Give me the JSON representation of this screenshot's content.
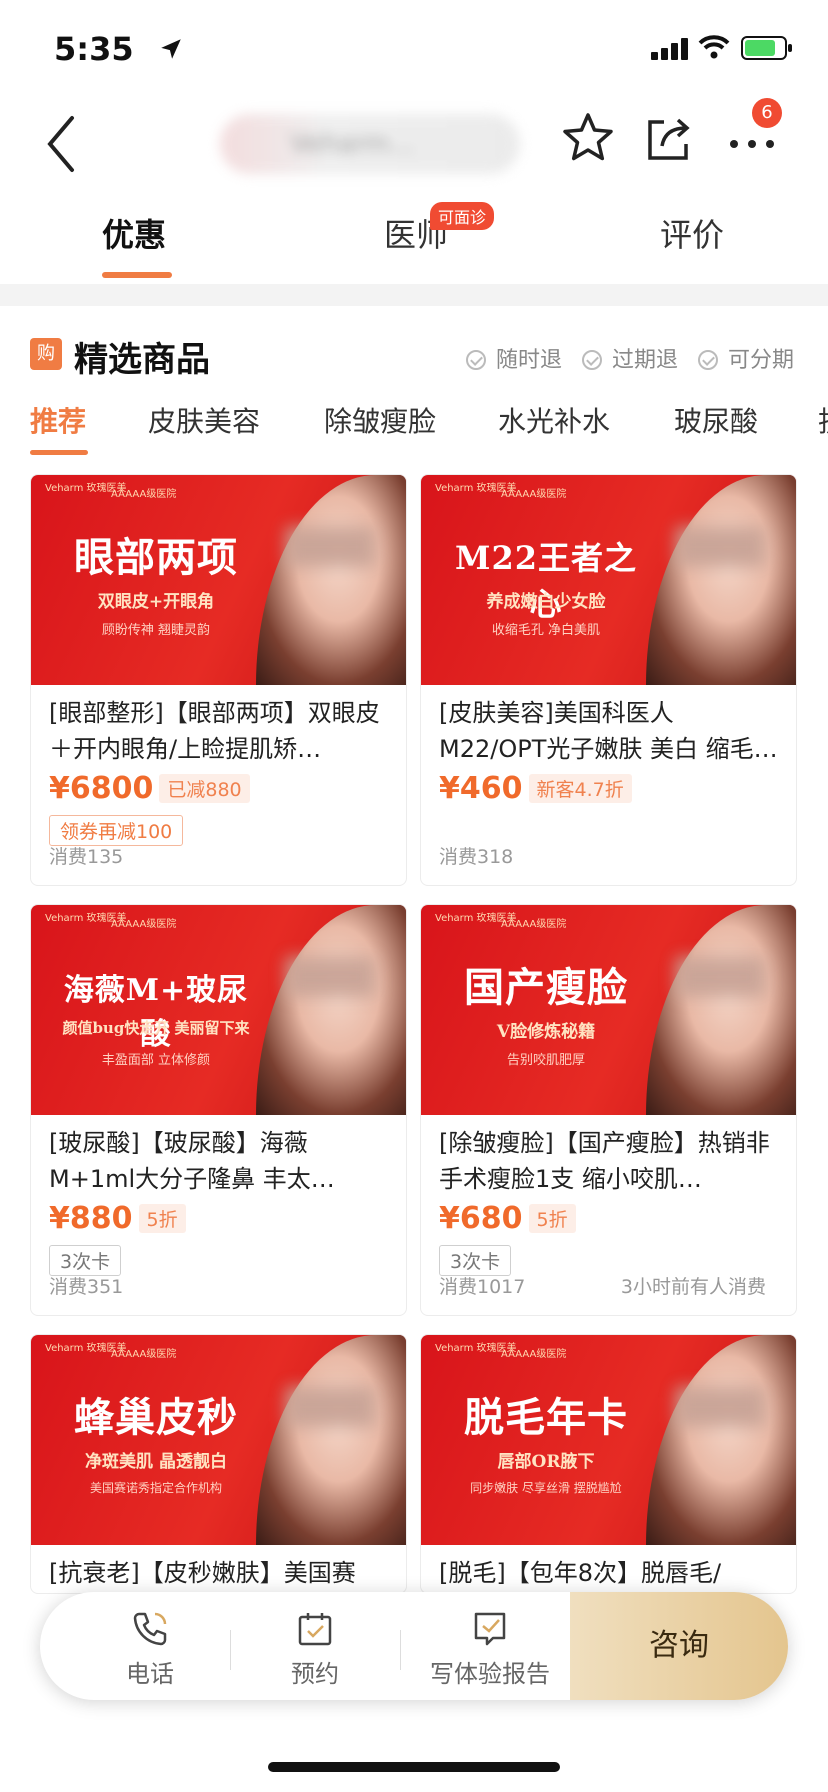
{
  "status": {
    "time": "5:35"
  },
  "nav": {
    "shop_name": "Veharm…",
    "notification_count": "6"
  },
  "tabs": [
    {
      "label": "优惠"
    },
    {
      "label": "医师",
      "badge": "可面诊"
    },
    {
      "label": "评价"
    }
  ],
  "section": {
    "icon_text": "购",
    "title": "精选商品",
    "assurances": [
      "随时退",
      "过期退",
      "可分期"
    ]
  },
  "categories": [
    "推荐",
    "皮肤美容",
    "除皱瘦脸",
    "水光补水",
    "玻尿酸",
    "抗"
  ],
  "products": [
    {
      "banner_title": "眼部两项",
      "banner_sub": "双眼皮+开眼角",
      "banner_small": "顾盼传神 翘睫灵韵",
      "title": "[眼部整形]【眼部两项】双眼皮＋开内眼角/上睑提肌矫…",
      "price": "¥6800",
      "badge": "已减880",
      "coupon": "领券再减100",
      "sales": "消费135",
      "recent": ""
    },
    {
      "banner_title": "M22王者之心",
      "banner_sub": "养成嫩白少女脸",
      "banner_small": "收缩毛孔 净白美肌",
      "title": "[皮肤美容]美国科医人M22/OPT光子嫩肤 美白 缩毛…",
      "price": "¥460",
      "badge": "新客4.7折",
      "coupon": "",
      "sales": "消费318",
      "recent": ""
    },
    {
      "banner_title": "海薇M+玻尿酸",
      "banner_sub": "颜值bug快走开 美丽留下来",
      "banner_small": "丰盈面部 立体修颜",
      "title": "[玻尿酸]【玻尿酸】海薇M+1ml大分子隆鼻 丰太…",
      "price": "¥880",
      "badge": "5折",
      "tag": "3次卡",
      "sales": "消费351",
      "recent": ""
    },
    {
      "banner_title": "国产瘦脸",
      "banner_sub": "V脸修炼秘籍",
      "banner_small": "告别咬肌肥厚",
      "title": "[除皱瘦脸]【国产瘦脸】热销非手术瘦脸1支 缩小咬肌…",
      "price": "¥680",
      "badge": "5折",
      "tag": "3次卡",
      "sales": "消费1017",
      "recent": "3小时前有人消费"
    },
    {
      "banner_title": "蜂巢皮秒",
      "banner_sub": "净斑美肌 晶透靓白",
      "banner_small": "美国赛诺秀指定合作机构",
      "title": "[抗衰老]【皮秒嫩肤】美国赛",
      "price": "",
      "badge": "",
      "sales": "",
      "recent": ""
    },
    {
      "banner_title": "脱毛年卡",
      "banner_sub": "唇部OR腋下",
      "banner_small": "同步嫩肤 尽享丝滑 摆脱尴尬",
      "title": "[脱毛]【包年8次】脱唇毛/",
      "price": "",
      "badge": "",
      "sales": "",
      "recent": ""
    }
  ],
  "banner_brand": {
    "logo": "Veharm 玫瑰医美",
    "hospital": "AAAAA级医院"
  },
  "actionbar": {
    "phone": "电话",
    "book": "预约",
    "report": "写体验报告",
    "consult": "咨询"
  },
  "colors": {
    "accent": "#f07c43",
    "price": "#f06a2b",
    "banner_red": "#e62b24",
    "consult_gold": "#e4c58e"
  }
}
